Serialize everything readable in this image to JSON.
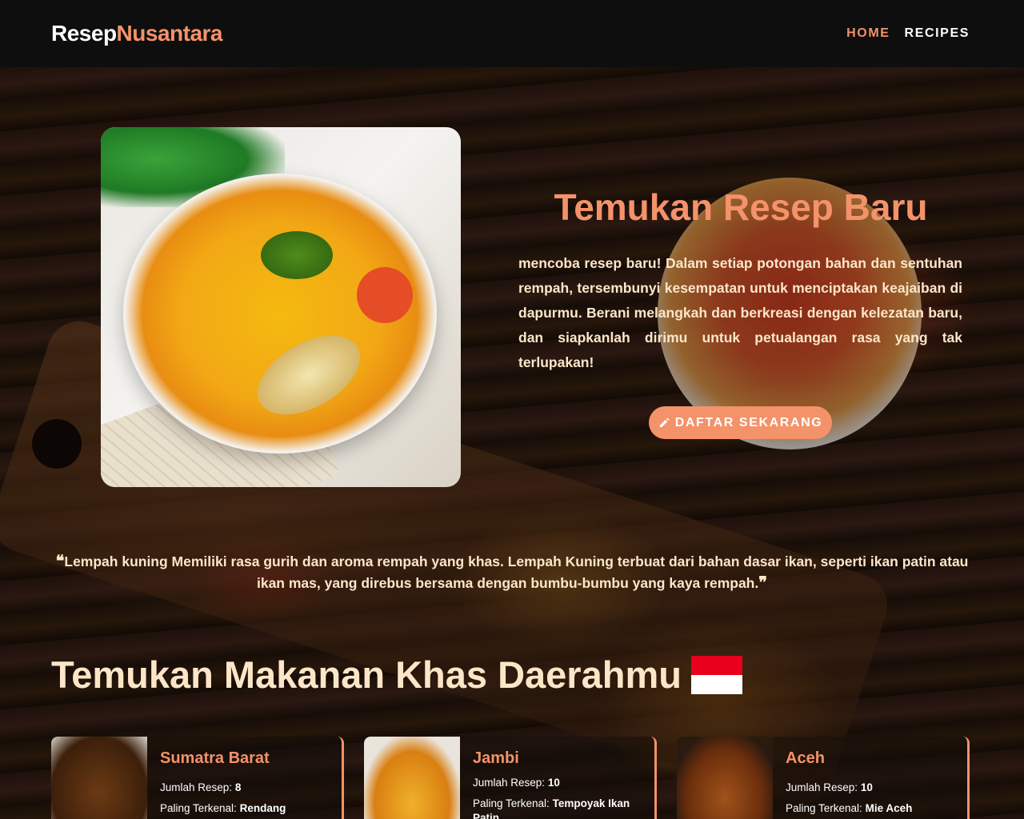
{
  "brand": {
    "part1": "Resep",
    "part2": "Nusantara"
  },
  "nav": {
    "home": "HOME",
    "recipes": "RECIPES"
  },
  "hero": {
    "title": "Temukan Resep Baru",
    "text": "mencoba resep baru! Dalam setiap potongan bahan dan sentuhan rempah, tersembunyi kesempatan untuk menciptakan keajaiban di dapurmu. Berani melangkah dan berkreasi dengan kelezatan baru, dan siapkanlah dirimu untuk petualangan rasa yang tak terlupakan!",
    "cta_label": "DAFTAR SEKARANG",
    "cta_icon": "pencil-icon"
  },
  "quote": {
    "open": "❝",
    "text": "Lempah kuning Memiliki rasa gurih dan aroma rempah yang khas. Lempah Kuning terbuat dari bahan dasar ikan, seperti ikan patin atau ikan mas, yang direbus bersama dengan bumbu-bumbu yang kaya rempah.",
    "close": "❞"
  },
  "section": {
    "title": "Temukan Makanan Khas Daerahmu"
  },
  "cards": [
    {
      "region": "Sumatra Barat",
      "count_label": "Jumlah Resep:",
      "count": "8",
      "famous_label": "Paling Terkenal:",
      "famous": "Rendang"
    },
    {
      "region": "Jambi",
      "count_label": "Jumlah Resep:",
      "count": "10",
      "famous_label": "Paling Terkenal:",
      "famous": "Tempoyak Ikan Patin"
    },
    {
      "region": "Aceh",
      "count_label": "Jumlah Resep:",
      "count": "10",
      "famous_label": "Paling Terkenal:",
      "famous": "Mie Aceh"
    }
  ],
  "colors": {
    "accent": "#f4926a",
    "cream": "#fde6c8",
    "navbar": "#0e0e0e"
  }
}
